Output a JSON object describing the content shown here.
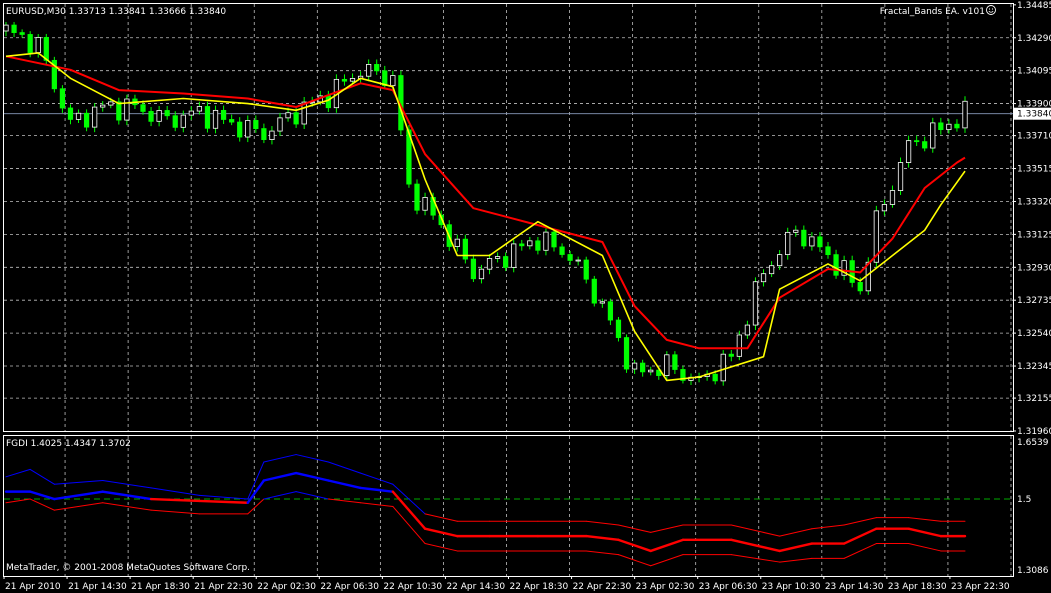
{
  "header": {
    "symbol_info": "EURUSD,M30  1.33713 1.33841 1.33666 1.33840",
    "ea_label": "Fractal_Bands EA. v101",
    "ea_icon": "smiley-icon"
  },
  "indicator": {
    "label": "FGDI 1.4025 1.4347 1.3702"
  },
  "copyright": "MetaTrader, © 2001-2008 MetaQuotes Software Corp.",
  "colors": {
    "background": "#000000",
    "grid": "#c0c0c0",
    "bull_candle": "#ffffff",
    "bear_candle": "#00ff00",
    "red_line": "#ff0000",
    "yellow_line": "#ffff00",
    "blue_band": "#0000ff",
    "level_line": "#00aa00",
    "text": "#ffffff"
  },
  "chart_data": [
    {
      "type": "line",
      "ylim": [
        1.3196,
        1.3449
      ],
      "y_ticks": [
        "1.34485",
        "1.34290",
        "1.34095",
        "1.33900",
        "1.33710",
        "1.33515",
        "1.33320",
        "1.33125",
        "1.32930",
        "1.32735",
        "1.32540",
        "1.32345",
        "1.32155",
        "1.31960"
      ],
      "current_price": "1.33840",
      "x_ticks": [
        "21 Apr 2010",
        "21 Apr 14:30",
        "21 Apr 18:30",
        "21 Apr 22:30",
        "22 Apr 02:30",
        "22 Apr 06:30",
        "22 Apr 10:30",
        "22 Apr 14:30",
        "22 Apr 18:30",
        "22 Apr 22:30",
        "23 Apr 02:30",
        "23 Apr 06:30",
        "23 Apr 10:30",
        "23 Apr 14:30",
        "23 Apr 18:30",
        "23 Apr 22:30"
      ],
      "x_count": 120,
      "close_points": [
        [
          0,
          1.3433
        ],
        [
          4,
          1.3425
        ],
        [
          8,
          1.3378
        ],
        [
          12,
          1.3388
        ],
        [
          16,
          1.3388
        ],
        [
          20,
          1.338
        ],
        [
          24,
          1.3385
        ],
        [
          28,
          1.3378
        ],
        [
          32,
          1.3372
        ],
        [
          36,
          1.3385
        ],
        [
          40,
          1.3395
        ],
        [
          44,
          1.341
        ],
        [
          48,
          1.3405
        ],
        [
          50,
          1.334
        ],
        [
          54,
          1.3318
        ],
        [
          58,
          1.329
        ],
        [
          62,
          1.33
        ],
        [
          66,
          1.331
        ],
        [
          70,
          1.33
        ],
        [
          74,
          1.327
        ],
        [
          78,
          1.323
        ],
        [
          82,
          1.3235
        ],
        [
          86,
          1.3225
        ],
        [
          90,
          1.324
        ],
        [
          94,
          1.329
        ],
        [
          98,
          1.3315
        ],
        [
          102,
          1.33
        ],
        [
          106,
          1.328
        ],
        [
          108,
          1.332
        ],
        [
          112,
          1.3365
        ],
        [
          116,
          1.3375
        ],
        [
          119,
          1.3384
        ]
      ],
      "series": [
        {
          "values": [
            [
              0,
              1.3418
            ],
            [
              8,
              1.341
            ],
            [
              14,
              1.3398
            ],
            [
              22,
              1.3396
            ],
            [
              30,
              1.3393
            ],
            [
              36,
              1.3388
            ],
            [
              40,
              1.3395
            ],
            [
              44,
              1.3402
            ],
            [
              48,
              1.3398
            ],
            [
              52,
              1.336
            ],
            [
              58,
              1.3328
            ],
            [
              66,
              1.3318
            ],
            [
              74,
              1.3308
            ],
            [
              78,
              1.327
            ],
            [
              82,
              1.325
            ],
            [
              86,
              1.3245
            ],
            [
              92,
              1.3245
            ],
            [
              96,
              1.3275
            ],
            [
              102,
              1.3292
            ],
            [
              106,
              1.329
            ],
            [
              110,
              1.331
            ],
            [
              114,
              1.334
            ],
            [
              118,
              1.3355
            ],
            [
              119,
              1.3358
            ]
          ]
        },
        {
          "values": [
            [
              0,
              1.3418
            ],
            [
              4,
              1.342
            ],
            [
              8,
              1.3405
            ],
            [
              14,
              1.339
            ],
            [
              22,
              1.3393
            ],
            [
              30,
              1.339
            ],
            [
              36,
              1.3386
            ],
            [
              40,
              1.3392
            ],
            [
              44,
              1.3405
            ],
            [
              48,
              1.34
            ],
            [
              52,
              1.3345
            ],
            [
              56,
              1.33
            ],
            [
              60,
              1.33
            ],
            [
              66,
              1.332
            ],
            [
              74,
              1.33
            ],
            [
              78,
              1.3255
            ],
            [
              82,
              1.3226
            ],
            [
              86,
              1.3228
            ],
            [
              94,
              1.324
            ],
            [
              96,
              1.328
            ],
            [
              102,
              1.3295
            ],
            [
              106,
              1.3285
            ],
            [
              110,
              1.33
            ],
            [
              114,
              1.3315
            ],
            [
              116,
              1.333
            ],
            [
              119,
              1.335
            ]
          ]
        }
      ]
    },
    {
      "type": "line",
      "ylim": [
        1.3086,
        1.6539
      ],
      "y_ticks": [
        "1.6539",
        "1.5",
        "1.3086"
      ],
      "level": 1.5,
      "series": [
        {
          "values": [
            [
              0,
              1.52
            ],
            [
              3,
              1.52
            ],
            [
              6,
              1.5
            ],
            [
              12,
              1.52
            ],
            [
              18,
              1.5
            ],
            [
              24,
              1.495
            ],
            [
              30,
              1.49
            ],
            [
              32,
              1.55
            ],
            [
              36,
              1.57
            ],
            [
              40,
              1.55
            ],
            [
              44,
              1.53
            ],
            [
              48,
              1.52
            ],
            [
              52,
              1.42
            ],
            [
              56,
              1.4
            ],
            [
              60,
              1.4
            ],
            [
              66,
              1.4
            ],
            [
              72,
              1.4
            ],
            [
              76,
              1.39
            ],
            [
              80,
              1.36
            ],
            [
              84,
              1.39
            ],
            [
              90,
              1.39
            ],
            [
              96,
              1.36
            ],
            [
              100,
              1.38
            ],
            [
              104,
              1.38
            ],
            [
              108,
              1.42
            ],
            [
              112,
              1.42
            ],
            [
              116,
              1.4
            ],
            [
              119,
              1.4
            ]
          ]
        },
        {
          "values": [
            [
              0,
              1.56
            ],
            [
              3,
              1.58
            ],
            [
              6,
              1.54
            ],
            [
              12,
              1.55
            ],
            [
              18,
              1.53
            ],
            [
              24,
              1.51
            ],
            [
              30,
              1.5
            ],
            [
              32,
              1.6
            ],
            [
              36,
              1.62
            ],
            [
              40,
              1.6
            ],
            [
              44,
              1.57
            ],
            [
              48,
              1.54
            ],
            [
              52,
              1.46
            ],
            [
              56,
              1.44
            ],
            [
              60,
              1.44
            ],
            [
              66,
              1.44
            ],
            [
              72,
              1.44
            ],
            [
              76,
              1.43
            ],
            [
              80,
              1.41
            ],
            [
              84,
              1.43
            ],
            [
              90,
              1.43
            ],
            [
              96,
              1.4
            ],
            [
              100,
              1.42
            ],
            [
              104,
              1.43
            ],
            [
              108,
              1.45
            ],
            [
              112,
              1.45
            ],
            [
              116,
              1.44
            ],
            [
              119,
              1.44
            ]
          ]
        },
        {
          "values": [
            [
              0,
              1.49
            ],
            [
              3,
              1.5
            ],
            [
              6,
              1.47
            ],
            [
              12,
              1.49
            ],
            [
              18,
              1.47
            ],
            [
              24,
              1.46
            ],
            [
              30,
              1.46
            ],
            [
              32,
              1.5
            ],
            [
              36,
              1.52
            ],
            [
              40,
              1.5
            ],
            [
              44,
              1.49
            ],
            [
              48,
              1.48
            ],
            [
              52,
              1.38
            ],
            [
              56,
              1.36
            ],
            [
              60,
              1.36
            ],
            [
              66,
              1.36
            ],
            [
              72,
              1.36
            ],
            [
              76,
              1.35
            ],
            [
              80,
              1.32
            ],
            [
              84,
              1.35
            ],
            [
              90,
              1.35
            ],
            [
              96,
              1.33
            ],
            [
              100,
              1.34
            ],
            [
              104,
              1.34
            ],
            [
              108,
              1.38
            ],
            [
              112,
              1.38
            ],
            [
              116,
              1.36
            ],
            [
              119,
              1.36
            ]
          ]
        }
      ]
    }
  ]
}
